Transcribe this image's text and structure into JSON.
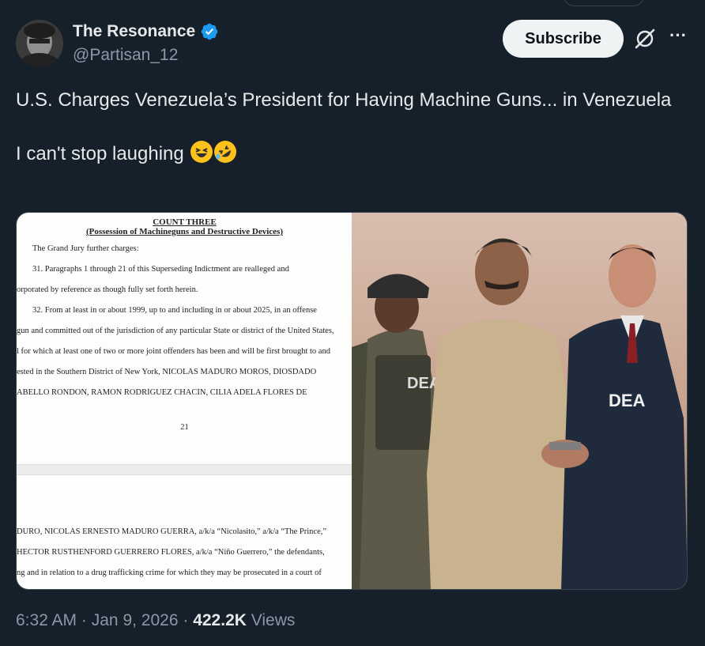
{
  "author": {
    "display_name": "The Resonance",
    "handle": "@Partisan_12",
    "verified": true,
    "avatar_icon": "avatar-photo"
  },
  "actions": {
    "subscribe_label": "Subscribe",
    "grok_icon": "grok-icon",
    "more_icon": "more-icon"
  },
  "tweet": {
    "line1": "U.S. Charges Venezuela’s President for Having Machine Guns... in Venezuela",
    "line2": "I can't stop laughing",
    "emojis": [
      "grinning-squinting-face",
      "rolling-on-floor-laughing"
    ]
  },
  "media": {
    "document": {
      "heading": "COUNT THREE",
      "subheading": "(Possession of Machineguns and Destructive Devices)",
      "lines": [
        "The Grand Jury further charges:",
        "31.      Paragraphs 1 through 21 of this Superseding Indictment are realleged and",
        "orporated by reference as though fully set forth herein.",
        "32.      From at least in or about 1999, up to and including in or about 2025, in an offense",
        "gun and committed out of the jurisdiction of any particular State or district of the United States,",
        "l for which at least one of two or more joint offenders has been and will be first brought to and",
        "ested in the Southern District of New York, NICOLÁS MADURO MOROS, DIOSDADO",
        "ABELLO RONDÓN, RAMÓN RODRÍGUEZ CHACÍN, CILIA ADELA FLORES DE"
      ],
      "page_number": "21",
      "lines_page2": [
        "DURO, NICOLÁS ERNESTO MADURO GUERRA, a/k/a “Nicolasito,” a/k/a “The Prince,”",
        "HECTOR RUSTHENFORD GUERRERO FLORES, a/k/a “Niño Guerrero,” the defendants,",
        "ng and in relation to a drug trafficking crime for which they may be prosecuted in a court of"
      ]
    },
    "photo": {
      "vest_text_left": "DEA",
      "jacket_text_right": "DEA"
    }
  },
  "meta": {
    "time": "6:32 AM",
    "separator": "·",
    "date": "Jan 9, 2026",
    "views_count": "422.2K",
    "views_label": "Views"
  },
  "colors": {
    "background": "#15202b",
    "text": "#e7e9ea",
    "secondary": "#8b98a5",
    "verified": "#1d9bf0",
    "subscribe_bg": "#eff3f4"
  }
}
